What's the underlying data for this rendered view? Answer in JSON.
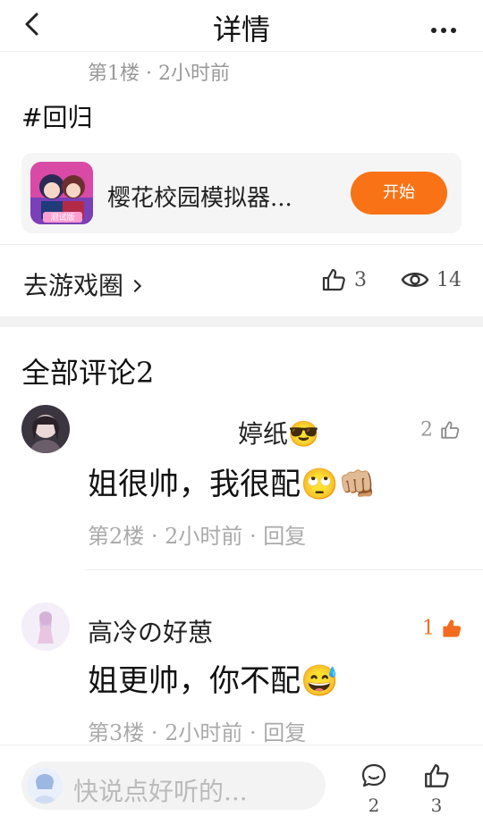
{
  "header": {
    "title": "详情"
  },
  "post": {
    "floor_meta": "第1楼 · 2小时前",
    "hashtag": "#回归",
    "game": {
      "name": "樱花校园模拟器...",
      "start_label": "开始",
      "badge_text": "测试版"
    },
    "goto_circle": "去游戏圈",
    "likes": "3",
    "views": "14"
  },
  "comments_section": {
    "title": "全部评论2",
    "comments": [
      {
        "name": "婷纸😎",
        "text": "姐很帅，我很配🙄👊🏼",
        "meta": "第2楼 · 2小时前 · 回复",
        "likes": "2"
      },
      {
        "name": "高冷の好葸",
        "text": "姐更帅，你不配😅",
        "meta": "第3楼 · 2小时前 · 回复",
        "likes": "1"
      }
    ]
  },
  "bottom": {
    "placeholder": "快说点好听的...",
    "comment_count": "2",
    "like_count": "3"
  },
  "colors": {
    "accent": "#f97316",
    "like_active": "#f36d21",
    "meta_gray": "#999999"
  }
}
